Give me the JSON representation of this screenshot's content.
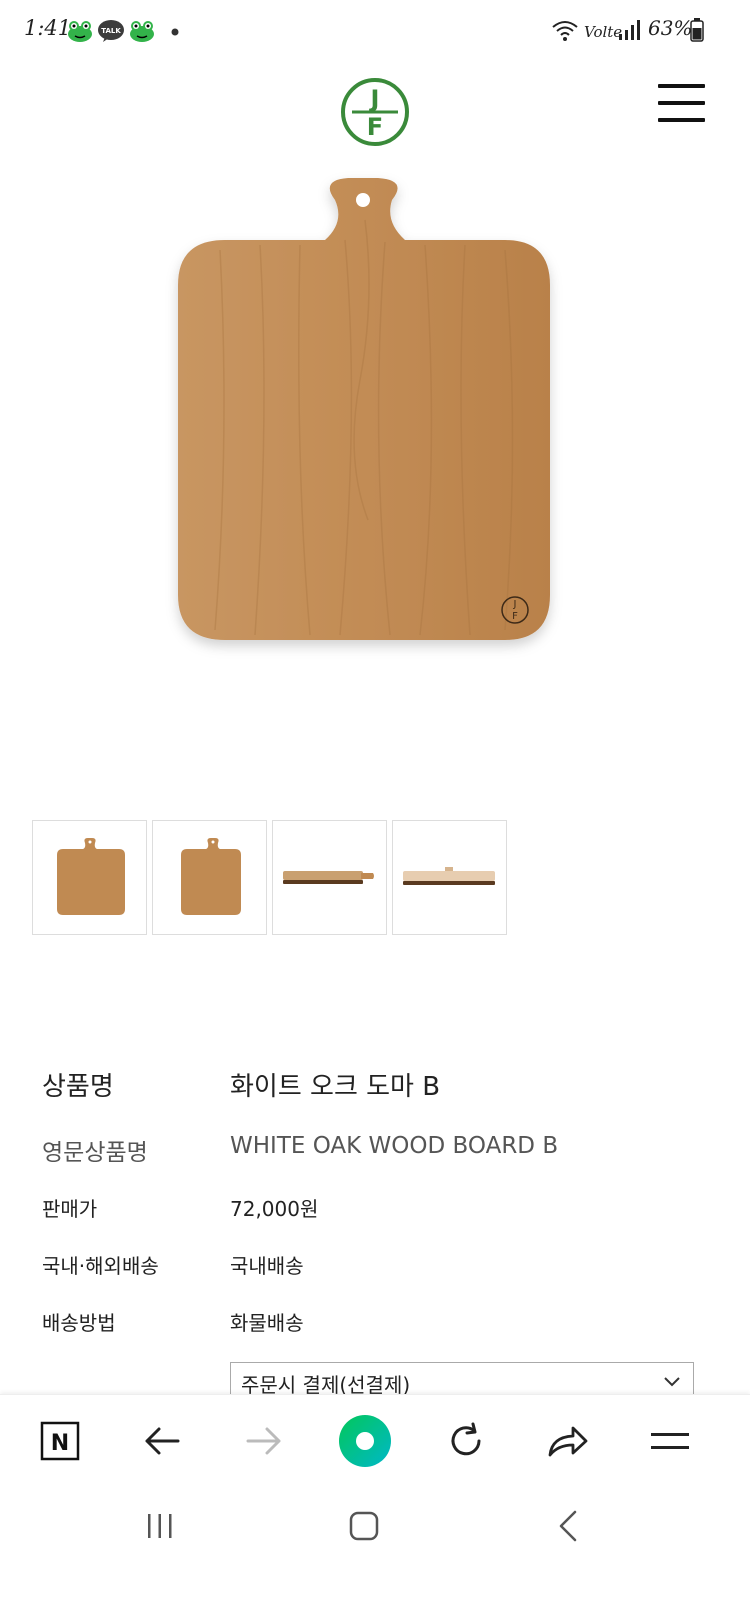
{
  "status_bar": {
    "time": "1:41",
    "network": "Volte",
    "battery": "63%",
    "icons": [
      "frog-icon",
      "kakaotalk-icon",
      "frog-icon",
      "dot-icon",
      "wifi-icon",
      "signal-icon",
      "battery-icon"
    ],
    "talk_label": "TALK"
  },
  "header": {
    "logo_text": "JF",
    "logo_color": "#3a8a3a",
    "menu_icon": "hamburger-menu-icon"
  },
  "product": {
    "rows": [
      {
        "label": "상품명",
        "value": "화이트 오크 도마 B"
      },
      {
        "label": "영문상품명",
        "value": "WHITE OAK WOOD BOARD B"
      },
      {
        "label": "판매가",
        "value": "72,000원"
      },
      {
        "label": "국내·해외배송",
        "value": "국내배송"
      },
      {
        "label": "배송방법",
        "value": "화물배송"
      }
    ],
    "payment_select": "주문시 결제(선결제)"
  },
  "thumbnails": [
    "front-view",
    "front-view-alt",
    "side-view",
    "side-view-alt"
  ],
  "browser_bar": {
    "buttons": [
      "naver-home-icon",
      "back-arrow-icon",
      "forward-arrow-icon",
      "green-dot-icon",
      "refresh-icon",
      "share-icon",
      "menu-icon"
    ],
    "naver_letter": "N",
    "accent": "#03c75a"
  },
  "colors": {
    "wood": "#c08a52",
    "wood_dark": "#a8743f",
    "brand_green": "#3a8a3a"
  }
}
